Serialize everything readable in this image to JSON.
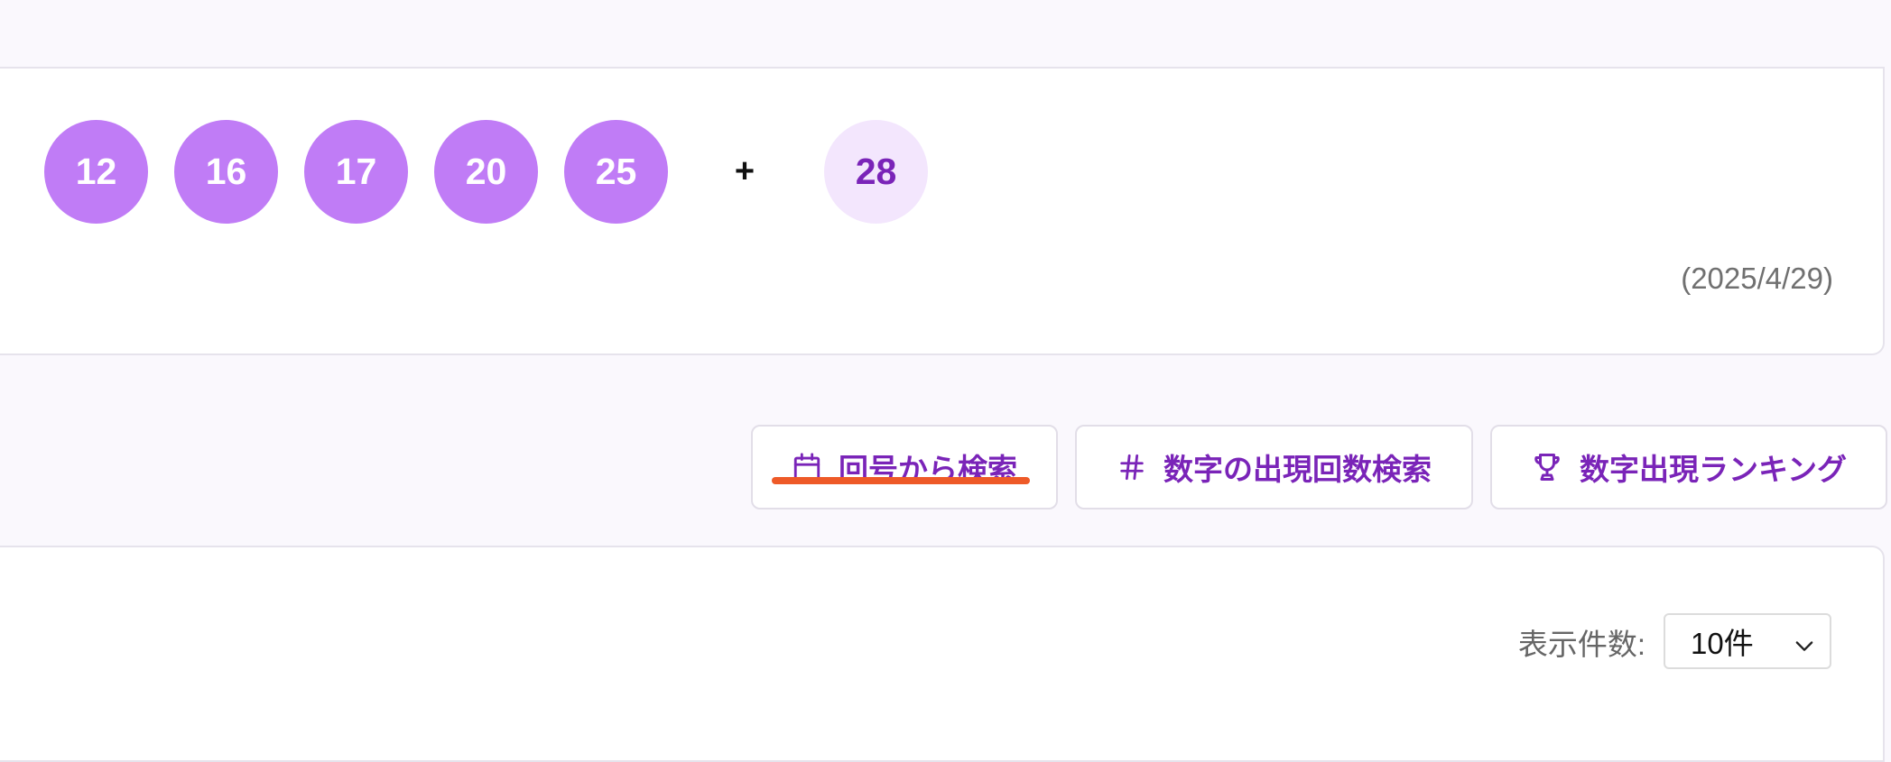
{
  "result": {
    "main_numbers": [
      "12",
      "16",
      "17",
      "20",
      "25"
    ],
    "plus_symbol": "+",
    "bonus_number": "28",
    "date": "(2025/4/29)"
  },
  "nav_buttons": [
    {
      "label": "回号から検索",
      "icon": "calendar-icon",
      "active": true
    },
    {
      "label": "数字の出現回数検索",
      "icon": "hash-icon"
    },
    {
      "label": "数字出現ランキング",
      "icon": "trophy-icon"
    }
  ],
  "list": {
    "count_label": "表示件数:",
    "count_value": "10件"
  },
  "colors": {
    "main_ball": "#c07cf6",
    "bonus_ball_bg": "#f3e6fd",
    "bonus_ball_text": "#7a24b8",
    "accent": "#7a24b8",
    "highlight_underline": "#ee5a28",
    "page_bg": "#faf8fd"
  }
}
